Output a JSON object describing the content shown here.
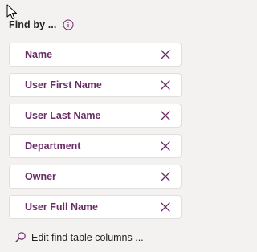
{
  "header": {
    "label": "Find by ...",
    "info_icon": "info-icon"
  },
  "find_columns": [
    {
      "label": "Name"
    },
    {
      "label": "User First Name"
    },
    {
      "label": "User Last Name"
    },
    {
      "label": "Department"
    },
    {
      "label": "Owner"
    },
    {
      "label": "User Full Name"
    }
  ],
  "edit_link": {
    "label": "Edit find table columns ...",
    "icon": "search-icon"
  },
  "colors": {
    "accent": "#6b2c68",
    "background": "#f3f2f1",
    "chip_background": "#ffffff"
  }
}
